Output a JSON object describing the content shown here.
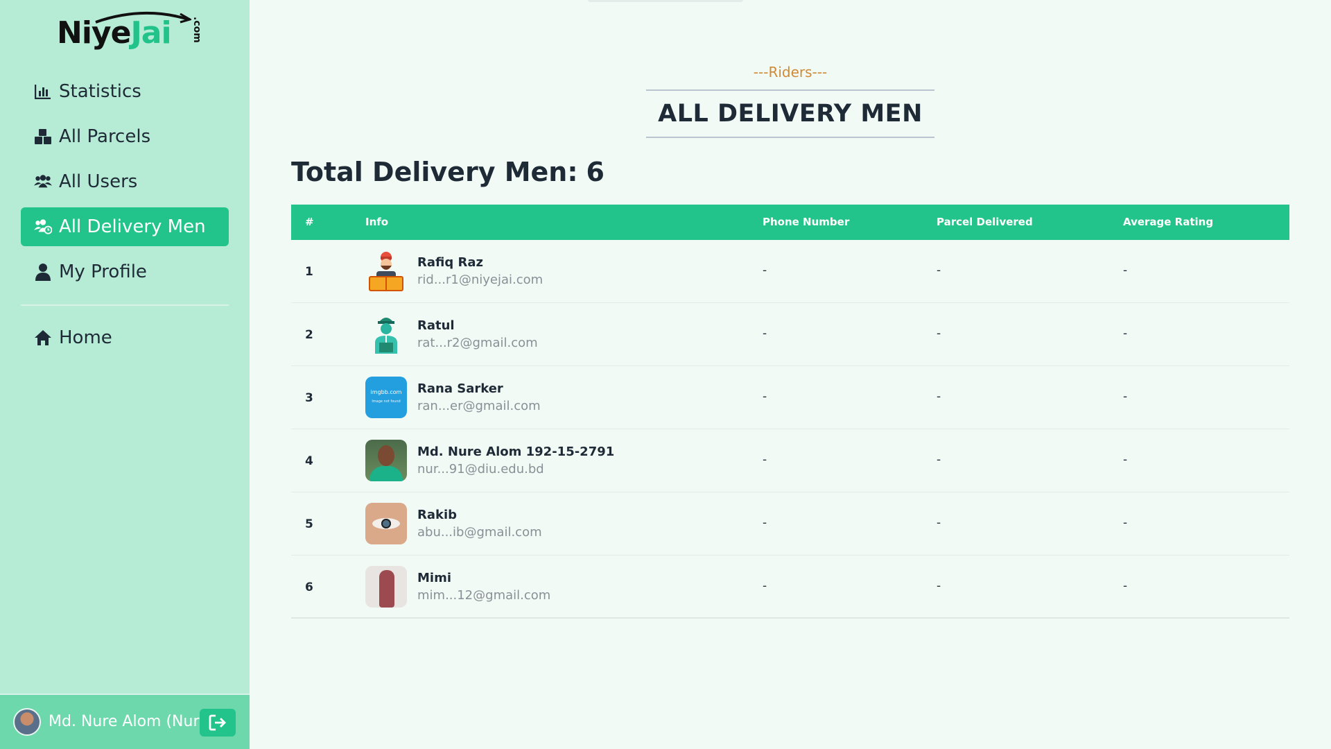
{
  "brand": {
    "prefix": "Niye",
    "accent": "Jai",
    "suffix": ".com",
    "accent_color": "#21c38a"
  },
  "sidebar": {
    "items": [
      {
        "label": "Statistics",
        "icon": "chart-icon",
        "active": false
      },
      {
        "label": "All Parcels",
        "icon": "boxes-icon",
        "active": false
      },
      {
        "label": "All Users",
        "icon": "users-icon",
        "active": false
      },
      {
        "label": "All Delivery Men",
        "icon": "delivery-men-icon",
        "active": true
      },
      {
        "label": "My Profile",
        "icon": "user-icon",
        "active": false
      },
      {
        "label": "Home",
        "icon": "home-icon",
        "active": false
      }
    ],
    "user": {
      "name": "Md. Nure Alom (Nur)"
    },
    "colors": {
      "background": "#b6ebd6",
      "active": "#22c48b"
    }
  },
  "main": {
    "subheading": "---Riders---",
    "title": "ALL DELIVERY MEN",
    "total_label": "Total Delivery Men:",
    "total_count": "6"
  },
  "table": {
    "headers": [
      "#",
      "Info",
      "Phone Number",
      "Parcel Delivered",
      "Average Rating"
    ],
    "rows": [
      {
        "index": "1",
        "name": "Rafiq Raz",
        "email": "rid...r1@niyejai.com",
        "phone": "-",
        "delivered": "-",
        "rating": "-"
      },
      {
        "index": "2",
        "name": "Ratul",
        "email": "rat...r2@gmail.com",
        "phone": "-",
        "delivered": "-",
        "rating": "-"
      },
      {
        "index": "3",
        "name": "Rana Sarker",
        "email": "ran...er@gmail.com",
        "phone": "-",
        "delivered": "-",
        "rating": "-"
      },
      {
        "index": "4",
        "name": "Md. Nure Alom 192-15-2791",
        "email": "nur...91@diu.edu.bd",
        "phone": "-",
        "delivered": "-",
        "rating": "-"
      },
      {
        "index": "5",
        "name": "Rakib",
        "email": "abu...ib@gmail.com",
        "phone": "-",
        "delivered": "-",
        "rating": "-"
      },
      {
        "index": "6",
        "name": "Mimi",
        "email": "mim...12@gmail.com",
        "phone": "-",
        "delivered": "-",
        "rating": "-"
      }
    ],
    "placeholder_image_text": {
      "title": "imgbb.com",
      "subtitle": "Image not found"
    },
    "header_color": "#22c48b"
  }
}
